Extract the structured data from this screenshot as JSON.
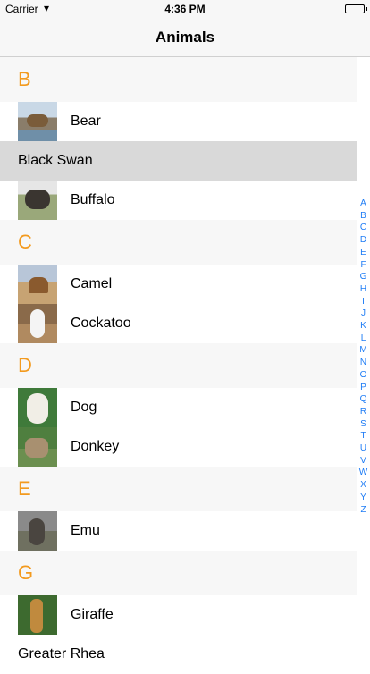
{
  "status": {
    "carrier": "Carrier",
    "time": "4:36 PM"
  },
  "nav": {
    "title": "Animals"
  },
  "sections": [
    {
      "header": "B",
      "rows": [
        {
          "label": "Bear",
          "icon": "bear-photo",
          "thumb": "t-bear"
        },
        {
          "label": "Black Swan",
          "selected": true
        },
        {
          "label": "Buffalo",
          "icon": "buffalo-photo",
          "thumb": "t-buffalo"
        }
      ]
    },
    {
      "header": "C",
      "rows": [
        {
          "label": "Camel",
          "icon": "camel-photo",
          "thumb": "t-camel"
        },
        {
          "label": "Cockatoo",
          "icon": "cockatoo-photo",
          "thumb": "t-cockatoo"
        }
      ]
    },
    {
      "header": "D",
      "rows": [
        {
          "label": "Dog",
          "icon": "dog-photo",
          "thumb": "t-dog"
        },
        {
          "label": "Donkey",
          "icon": "donkey-photo",
          "thumb": "t-donkey"
        }
      ]
    },
    {
      "header": "E",
      "rows": [
        {
          "label": "Emu",
          "icon": "emu-photo",
          "thumb": "t-emu"
        }
      ]
    },
    {
      "header": "G",
      "rows": [
        {
          "label": "Giraffe",
          "icon": "giraffe-photo",
          "thumb": "t-giraffe"
        },
        {
          "label": "Greater Rhea"
        }
      ]
    }
  ],
  "index": [
    "A",
    "B",
    "C",
    "D",
    "E",
    "F",
    "G",
    "H",
    "I",
    "J",
    "K",
    "L",
    "M",
    "N",
    "O",
    "P",
    "Q",
    "R",
    "S",
    "T",
    "U",
    "V",
    "W",
    "X",
    "Y",
    "Z"
  ],
  "colors": {
    "section_header_text": "#f39a1e",
    "index_text": "#1e7cf5",
    "selected_row": "#d9d9d9"
  }
}
